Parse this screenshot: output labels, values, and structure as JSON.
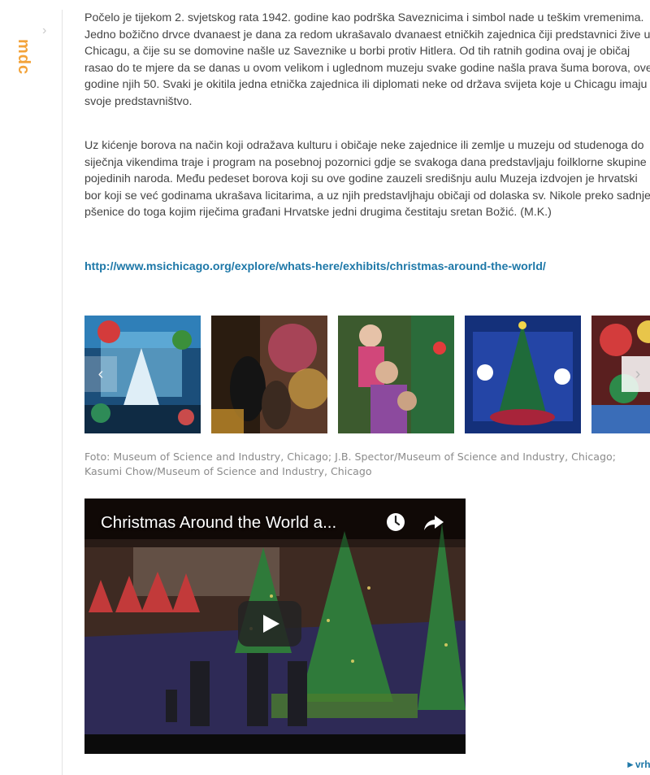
{
  "sidebar": {
    "label": "mdc",
    "chevron": "›"
  },
  "article": {
    "paragraph1": "Počelo je tijekom 2. svjetskog rata 1942. godine kao podrška Saveznicima i simbol nade u teškim vremenima. Jedno božično drvce dvanaest je dana za redom ukrašavalo dvanaest etničkih zajednica čiji predstavnici žive u Chicagu, a čije su se domovine našle uz Saveznike u borbi protiv Hitlera. Od tih ratnih godina ovaj je običaj rasao do te mjere da se danas u ovom velikom i uglednom muzeju svake godine našla prava šuma borova, ove godine njih 50. Svaki je okitila jedna etnička zajednica ili diplomati neke od država svijeta koje u Chicagu imaju svoje predstavništvo.",
    "paragraph2": "Uz kićenje borova na način koji odražava kulturu i običaje neke zajednice ili zemlje u muzeju od studenoga do siječnja vikendima traje i program na posebnoj pozornici gdje se svakoga dana predstavljaju foilklorne skupine pojedinih naroda. Među pedeset borova koji su ove godine zauzeli središnju aulu Muzeja izdvojen je hrvatski bor koji se već godinama ukrašava licitarima, a uz njih predstavljhaju običaji od dolaska sv. Nikole preko sadnje pšenice do toga kojim riječima građani Hrvatske jedni drugima čestitaju sretan Božić. (M.K.)",
    "link": "http://www.msichicago.org/explore/whats-here/exhibits/christmas-around-the-world/"
  },
  "gallery": {
    "prev_label": "‹",
    "next_label": "›",
    "caption": "Foto: Museum of Science and Industry, Chicago; J.B. Spector/Museum of Science and Industry, Chicago; Kasumi Chow/Museum of Science and Industry, Chicago"
  },
  "video": {
    "title": "Christmas Around the World a..."
  },
  "footer": {
    "more_label": "►vrh"
  }
}
